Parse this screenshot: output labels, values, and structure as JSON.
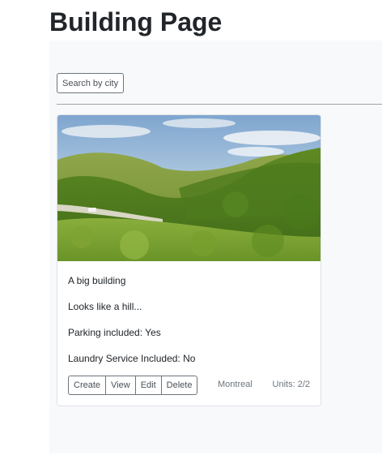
{
  "page": {
    "title": "Building Page"
  },
  "search": {
    "placeholder": "Search by city"
  },
  "buildings": [
    {
      "image_alt": "Green forested hill landscape",
      "name": "A big building",
      "description": "Looks like a hill...",
      "parking": "Parking included: Yes",
      "laundry": "Laundry Service Included: No",
      "city": "Montreal",
      "units": "Units: 2/2",
      "actions": {
        "create": "Create",
        "view": "View",
        "edit": "Edit",
        "delete": "Delete"
      }
    }
  ],
  "colors": {
    "panel_background": "#f8f9fa",
    "button_border": "#6c757d",
    "muted_text": "#6c757d"
  }
}
